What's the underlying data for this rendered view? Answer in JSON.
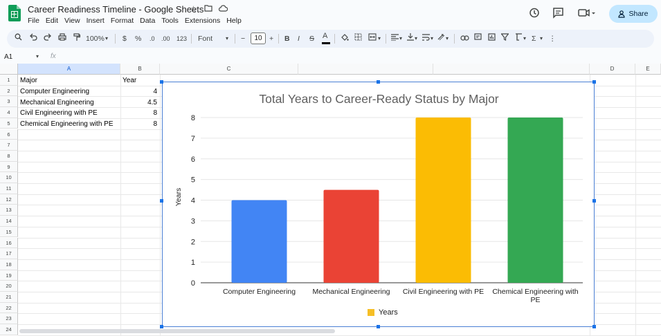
{
  "header": {
    "doc_title": "Career Readiness Timeline - Google Sheets",
    "menu": [
      "File",
      "Edit",
      "View",
      "Insert",
      "Format",
      "Data",
      "Tools",
      "Extensions",
      "Help"
    ],
    "share_label": "Share"
  },
  "toolbar": {
    "zoom": "100%",
    "currency": "$",
    "percent": "%",
    "decimal_decrease": ".0",
    "decimal_increase": ".00",
    "number_format": "123",
    "font": "Font",
    "font_size": "10",
    "bold": "B",
    "italic": "I",
    "strike": "S",
    "text_color": "A"
  },
  "formula_bar": {
    "name_box": "A1",
    "fx": "fx"
  },
  "sheet": {
    "columns": [
      "A",
      "B",
      "C",
      "D",
      "E"
    ],
    "rows": [
      "1",
      "2",
      "3",
      "4",
      "5",
      "6",
      "7",
      "8",
      "9",
      "10",
      "11",
      "12",
      "13",
      "14",
      "15",
      "16",
      "17",
      "18",
      "19",
      "20",
      "21",
      "22",
      "23",
      "24"
    ],
    "header_row": {
      "a": "Major",
      "b": "Year"
    },
    "data_rows": [
      {
        "a": "Computer Engineering",
        "b": "4"
      },
      {
        "a": "Mechanical Engineering",
        "b": "4.5"
      },
      {
        "a": "Civil Engineering with PE",
        "b": "8"
      },
      {
        "a": "Chemical Engineering with PE",
        "b": "8"
      }
    ]
  },
  "chart_data": {
    "type": "bar",
    "title": "Total Years to Career-Ready Status by Major",
    "xlabel": "",
    "ylabel": "Years",
    "categories": [
      "Computer Engineering",
      "Mechanical Engineering",
      "Civil Engineering with PE",
      "Chemical Engineering with PE"
    ],
    "category_tick_lines": [
      [
        "Computer Engineering"
      ],
      [
        "Mechanical Engineering"
      ],
      [
        "Civil Engineering with PE"
      ],
      [
        "Chemical Engineering with",
        "PE"
      ]
    ],
    "values": [
      4,
      4.5,
      8,
      8
    ],
    "colors": [
      "#4285f4",
      "#ea4335",
      "#fbbc04",
      "#34a853"
    ],
    "ylim": [
      0,
      8
    ],
    "yticks": [
      0,
      1,
      2,
      3,
      4,
      5,
      6,
      7,
      8
    ],
    "grid": true,
    "legend": {
      "label": "Years",
      "color": "#f6bf26",
      "position": "bottom"
    }
  }
}
